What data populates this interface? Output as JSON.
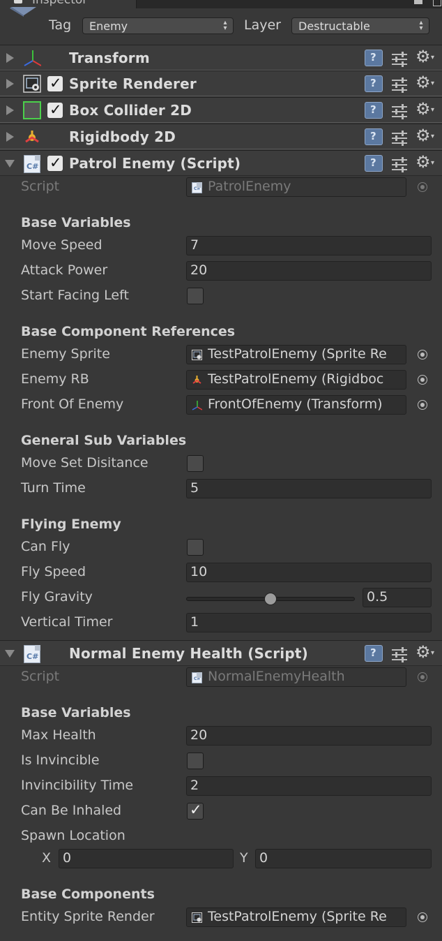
{
  "tab": {
    "title": "Inspector"
  },
  "header": {
    "tag_label": "Tag",
    "tag_value": "Enemy",
    "layer_label": "Layer",
    "layer_value": "Destructable"
  },
  "components": [
    {
      "title": "Transform",
      "expanded": false,
      "has_checkbox": false
    },
    {
      "title": "Sprite Renderer",
      "expanded": false,
      "has_checkbox": true,
      "checked": true
    },
    {
      "title": "Box Collider 2D",
      "expanded": false,
      "has_checkbox": true,
      "checked": true
    },
    {
      "title": "Rigidbody 2D",
      "expanded": false,
      "has_checkbox": false
    },
    {
      "title": "Patrol Enemy (Script)",
      "expanded": true,
      "has_checkbox": true,
      "checked": true
    },
    {
      "title": "Normal Enemy Health (Script)",
      "expanded": true,
      "has_checkbox": false
    }
  ],
  "patrol": {
    "script_label": "Script",
    "script_value": "PatrolEnemy",
    "base_variables": "Base Variables",
    "move_speed_label": "Move Speed",
    "move_speed": "7",
    "attack_power_label": "Attack Power",
    "attack_power": "20",
    "start_facing_left_label": "Start Facing Left",
    "start_facing_left": false,
    "base_component_refs": "Base Component References",
    "enemy_sprite_label": "Enemy Sprite",
    "enemy_sprite": "TestPatrolEnemy (Sprite Re",
    "enemy_rb_label": "Enemy RB",
    "enemy_rb": "TestPatrolEnemy (Rigidboc",
    "front_of_enemy_label": "Front Of Enemy",
    "front_of_enemy": "FrontOfEnemy (Transform)",
    "general_sub_variables": "General Sub Variables",
    "move_set_distance_label": "Move Set Disitance",
    "move_set_distance": false,
    "turn_time_label": "Turn Time",
    "turn_time": "5",
    "flying_enemy": "Flying Enemy",
    "can_fly_label": "Can Fly",
    "can_fly": false,
    "fly_speed_label": "Fly Speed",
    "fly_speed": "10",
    "fly_gravity_label": "Fly Gravity",
    "fly_gravity": "0.5",
    "fly_gravity_fraction": 0.5,
    "vertical_timer_label": "Vertical Timer",
    "vertical_timer": "1"
  },
  "health": {
    "script_label": "Script",
    "script_value": "NormalEnemyHealth",
    "base_variables": "Base Variables",
    "max_health_label": "Max Health",
    "max_health": "20",
    "is_invincible_label": "Is Invincible",
    "is_invincible": false,
    "invincibility_time_label": "Invincibility Time",
    "invincibility_time": "2",
    "can_be_inhaled_label": "Can Be Inhaled",
    "can_be_inhaled": true,
    "spawn_location_label": "Spawn Location",
    "spawn_x_label": "X",
    "spawn_x": "0",
    "spawn_y_label": "Y",
    "spawn_y": "0",
    "base_components": "Base Components",
    "entity_sprite_render_label": "Entity Sprite Render",
    "entity_sprite_render": "TestPatrolEnemy (Sprite Re"
  },
  "icons": {
    "transform": "transform-axes-icon",
    "sprite_renderer": "sprite-renderer-icon",
    "box_collider": "box-collider-icon",
    "rigidbody": "rigidbody-icon",
    "script": "csharp-script-icon",
    "help": "help-book-icon",
    "presets": "presets-sliders-icon",
    "settings": "gear-icon"
  },
  "colors": {
    "panel_bg": "#383838",
    "help_button": "#5b78a0",
    "field_bg": "#2f2f2f"
  }
}
